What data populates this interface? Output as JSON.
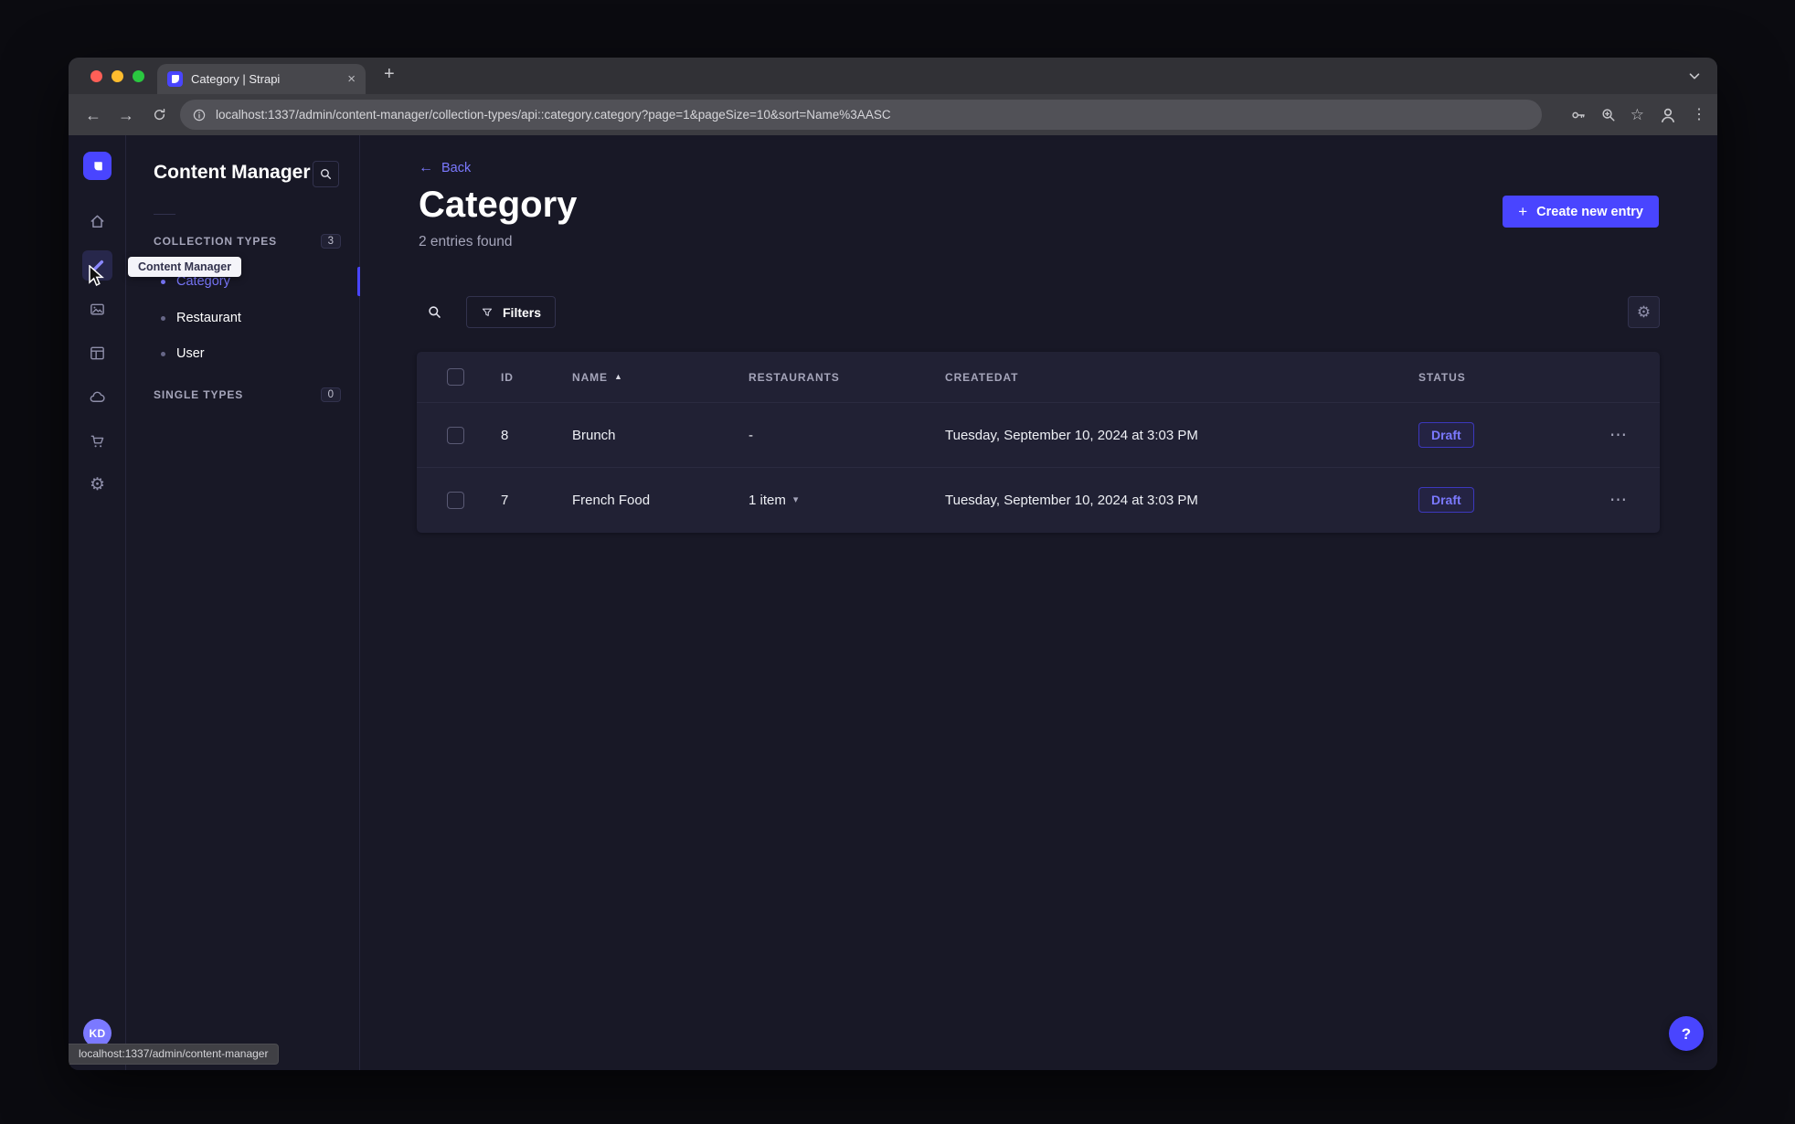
{
  "colors": {
    "accent": "#4945ff",
    "accent_light": "#7b79ff",
    "page_bg": "#181826",
    "card_bg": "#212134",
    "status_draft_text": "#7b79ff"
  },
  "icons": {
    "back_arrow": "←",
    "forward_arrow": "→",
    "plus": "+",
    "close": "×",
    "star": "☆",
    "kebab": "⋮",
    "more": "⋯",
    "caret_up": "▲",
    "caret_down": "▾",
    "gear": "⚙",
    "question": "?"
  },
  "browser": {
    "tab_title": "Category | Strapi",
    "url": "localhost:1337/admin/content-manager/collection-types/api::category.category?page=1&pageSize=10&sort=Name%3AASC",
    "status_text": "localhost:1337/admin/content-manager"
  },
  "rail": {
    "tooltip": "Content Manager",
    "avatar_initials": "KD"
  },
  "panel": {
    "title": "Content Manager",
    "collection_label": "COLLECTION TYPES",
    "collection_count": "3",
    "items": [
      {
        "label": "Category"
      },
      {
        "label": "Restaurant"
      },
      {
        "label": "User"
      }
    ],
    "single_label": "SINGLE TYPES",
    "single_count": "0"
  },
  "main": {
    "back_label": "Back",
    "title": "Category",
    "subtitle": "2 entries found",
    "create_label": "Create new entry",
    "filters_label": "Filters",
    "table": {
      "headers": [
        "ID",
        "NAME",
        "RESTAURANTS",
        "CREATEDAT",
        "STATUS"
      ],
      "rows": [
        {
          "id": "8",
          "name": "Brunch",
          "restaurants": "-",
          "createdAt": "Tuesday, September 10, 2024 at 3:03 PM",
          "status": "Draft"
        },
        {
          "id": "7",
          "name": "French Food",
          "restaurants": "1 item",
          "createdAt": "Tuesday, September 10, 2024 at 3:03 PM",
          "status": "Draft"
        }
      ]
    }
  }
}
